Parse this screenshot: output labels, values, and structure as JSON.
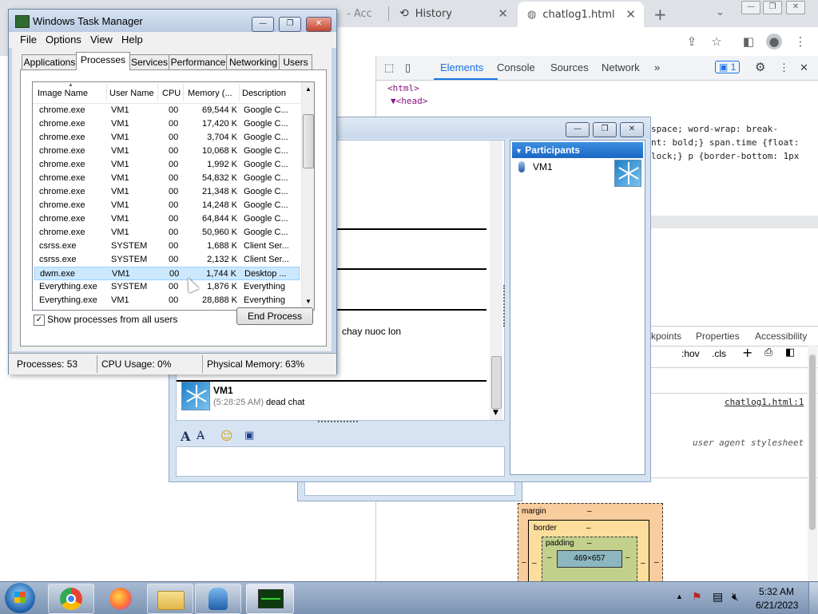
{
  "browser": {
    "tabs": [
      {
        "label": "- Acc"
      },
      {
        "label": "History"
      },
      {
        "label": "chatlog1.html"
      }
    ],
    "new_tab": "+",
    "devtools": {
      "tabs": [
        "Elements",
        "Console",
        "Sources",
        "Network",
        "»"
      ],
      "issues_count": "1",
      "code_lines": [
        "<html>",
        "▼<head>",
        "space; word-wrap: break-",
        "nt: bold;} span.time {float:",
        "lock;} p {border-bottom: 1px"
      ],
      "subtabs": [
        "kpoints",
        "Properties",
        "Accessibility"
      ],
      "filter_tools": [
        ":hov",
        ".cls",
        "+"
      ],
      "source_link": "chatlog1.html:1",
      "ua_label": "user agent stylesheet",
      "box_model": {
        "margin": "margin",
        "border": "border",
        "padding": "padding",
        "content": "469×657",
        "dash": "–"
      }
    }
  },
  "chat_window": {
    "participants_title": "Participants",
    "participant_name": "VM1",
    "snippet": "chay nuoc lon",
    "message": {
      "sender": "VM1",
      "time": "(5:28:25 AM)",
      "text": "dead chat"
    }
  },
  "task_manager": {
    "title": "Windows Task Manager",
    "menu": [
      "File",
      "Options",
      "View",
      "Help"
    ],
    "tabs": [
      "Applications",
      "Processes",
      "Services",
      "Performance",
      "Networking",
      "Users"
    ],
    "active_tab": "Processes",
    "columns": [
      "Image Name",
      "User Name",
      "CPU",
      "Memory (...",
      "Description"
    ],
    "rows": [
      {
        "image": "chrome.exe",
        "user": "VM1",
        "cpu": "00",
        "mem": "69,544 K",
        "desc": "Google C..."
      },
      {
        "image": "chrome.exe",
        "user": "VM1",
        "cpu": "00",
        "mem": "17,420 K",
        "desc": "Google C..."
      },
      {
        "image": "chrome.exe",
        "user": "VM1",
        "cpu": "00",
        "mem": "3,704 K",
        "desc": "Google C..."
      },
      {
        "image": "chrome.exe",
        "user": "VM1",
        "cpu": "00",
        "mem": "10,068 K",
        "desc": "Google C..."
      },
      {
        "image": "chrome.exe",
        "user": "VM1",
        "cpu": "00",
        "mem": "1,992 K",
        "desc": "Google C..."
      },
      {
        "image": "chrome.exe",
        "user": "VM1",
        "cpu": "00",
        "mem": "54,832 K",
        "desc": "Google C..."
      },
      {
        "image": "chrome.exe",
        "user": "VM1",
        "cpu": "00",
        "mem": "21,348 K",
        "desc": "Google C..."
      },
      {
        "image": "chrome.exe",
        "user": "VM1",
        "cpu": "00",
        "mem": "14,248 K",
        "desc": "Google C..."
      },
      {
        "image": "chrome.exe",
        "user": "VM1",
        "cpu": "00",
        "mem": "64,844 K",
        "desc": "Google C..."
      },
      {
        "image": "chrome.exe",
        "user": "VM1",
        "cpu": "00",
        "mem": "50,960 K",
        "desc": "Google C..."
      },
      {
        "image": "csrss.exe",
        "user": "SYSTEM",
        "cpu": "00",
        "mem": "1,688 K",
        "desc": "Client Ser..."
      },
      {
        "image": "csrss.exe",
        "user": "SYSTEM",
        "cpu": "00",
        "mem": "2,132 K",
        "desc": "Client Ser..."
      },
      {
        "image": "dwm.exe",
        "user": "VM1",
        "cpu": "00",
        "mem": "1,744 K",
        "desc": "Desktop ...",
        "selected": true
      },
      {
        "image": "Everything.exe",
        "user": "SYSTEM",
        "cpu": "00",
        "mem": "1,876 K",
        "desc": "Everything"
      },
      {
        "image": "Everything.exe",
        "user": "VM1",
        "cpu": "00",
        "mem": "28,888 K",
        "desc": "Everything"
      }
    ],
    "show_all_label": "Show processes from all users",
    "show_all_checked": true,
    "end_process": "End Process",
    "status": {
      "processes": "Processes: 53",
      "cpu": "CPU Usage: 0%",
      "memory": "Physical Memory: 63%"
    }
  },
  "taskbar": {
    "pinned": [
      "start-orb-icon",
      "chrome-icon",
      "firefox-icon",
      "file-explorer-icon",
      "network-user-icon",
      "task-manager-icon"
    ],
    "clock_time": "5:32 AM",
    "clock_date": "6/21/2023"
  }
}
